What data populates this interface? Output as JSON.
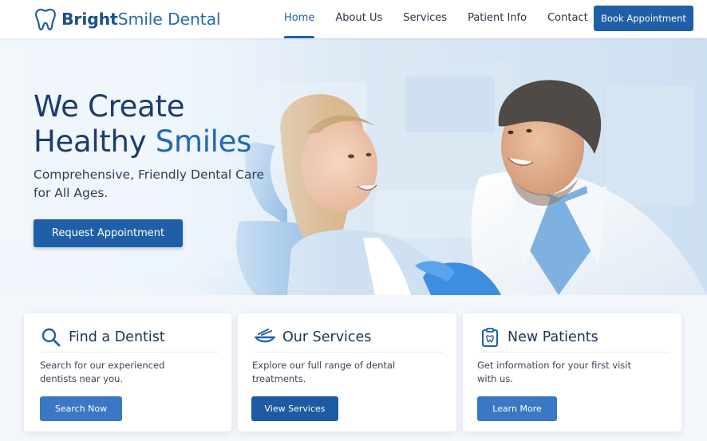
{
  "brand": {
    "name_strong": "Bright",
    "name_light": "Smile Dental",
    "logo_icon": "tooth-icon",
    "primary_color": "#1f5fa8",
    "heading_color": "#1c3c6b"
  },
  "nav": {
    "items": [
      {
        "label": "Home",
        "active": true
      },
      {
        "label": "About Us",
        "active": false
      },
      {
        "label": "Services",
        "active": false
      },
      {
        "label": "Patient Info",
        "active": false
      },
      {
        "label": "Contact",
        "active": false
      }
    ],
    "cta_label": "Book Appointment"
  },
  "hero": {
    "title_line1": "We Create",
    "title_line2_plain": "Healthy ",
    "title_line2_accent": "Smiles",
    "subtitle": "Comprehensive, Friendly Dental Care for All Ages.",
    "button_label": "Request Appointment",
    "image": "dentist-with-smiling-patient-photo"
  },
  "cards": [
    {
      "icon": "search-icon",
      "title": "Find a Dentist",
      "description": "Search for our experienced dentists near you.",
      "button_label": "Search Now"
    },
    {
      "icon": "dental-tray-icon",
      "title": "Our Services",
      "description": "Explore our full range of dental treatments.",
      "button_label": "View Services"
    },
    {
      "icon": "clipboard-tooth-icon",
      "title": "New Patients",
      "description": "Get information for your first visit with us.",
      "button_label": "Learn More"
    }
  ]
}
